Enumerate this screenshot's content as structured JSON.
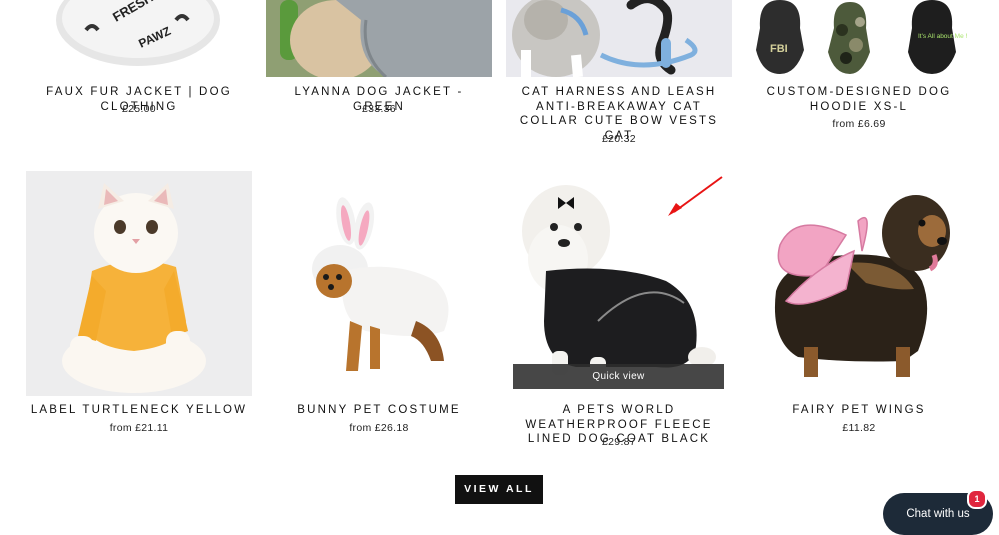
{
  "products": [
    {
      "title": "FAUX FUR JACKET | DOG CLOTHING",
      "price": "£25.00"
    },
    {
      "title": "LYANNA DOG JACKET - GREEN",
      "price": "£33.36"
    },
    {
      "title": "CAT HARNESS AND LEASH ANTI-BREAKAWAY CAT COLLAR CUTE BOW VESTS CAT",
      "price": "£20.32"
    },
    {
      "title": "CUSTOM-DESIGNED DOG HOODIE XS-L",
      "price": "from £6.69"
    },
    {
      "title": "LABEL TURTLENECK YELLOW",
      "price": "from £21.11"
    },
    {
      "title": "BUNNY PET COSTUME",
      "price": "from £26.18"
    },
    {
      "title": "A PETS WORLD WEATHERPROOF FLEECE LINED DOG COAT BLACK",
      "price": "£29.87"
    },
    {
      "title": "FAIRY PET WINGS",
      "price": "£11.82"
    }
  ],
  "images": {
    "hoodie_texts": [
      "FBI",
      "It's All about Me !"
    ],
    "fur_jacket_text": [
      "FRESH",
      "PAWZ"
    ]
  },
  "quick_view": "Quick view",
  "view_all": "VIEW ALL",
  "chat": {
    "label": "Chat with us",
    "badge": "1"
  }
}
